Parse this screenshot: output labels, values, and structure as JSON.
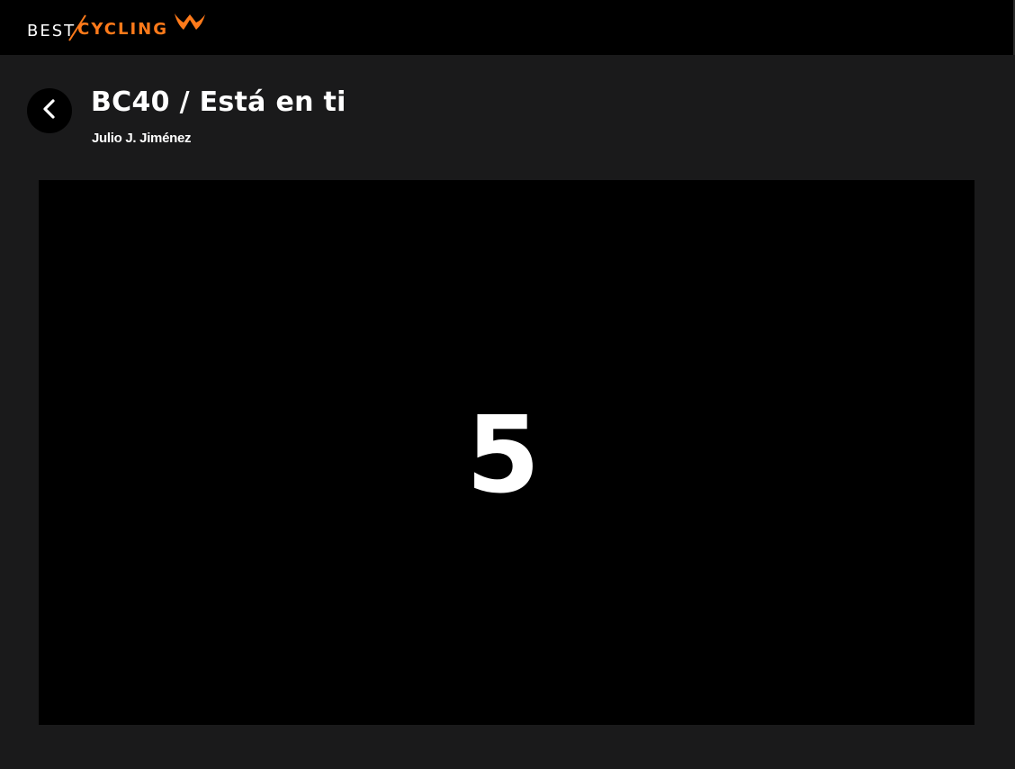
{
  "header": {
    "logo": {
      "part1": "BEST",
      "part2": "CYCLING",
      "accent_color": "#ff7a1a",
      "mark_icon": "bestcycling-w-logo-icon"
    }
  },
  "class_info": {
    "back_icon": "chevron-left-icon",
    "title": "BC40 / Está en ti",
    "instructor": "Julio J. Jiménez"
  },
  "player": {
    "countdown": "5"
  },
  "colors": {
    "background": "#1a1a1b",
    "topbar": "#000000",
    "video": "#000000",
    "text": "#ffffff",
    "accent": "#ff7a1a"
  }
}
